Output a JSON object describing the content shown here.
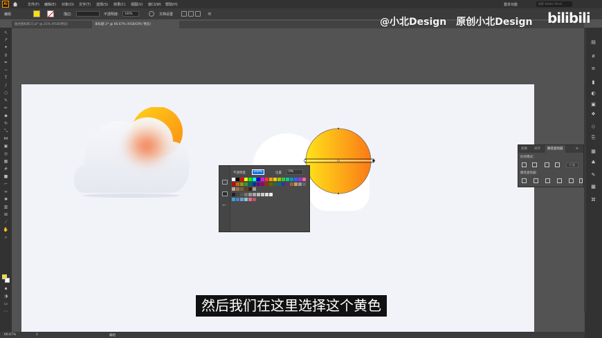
{
  "menubar": {
    "app_logo": "Ai",
    "items": [
      "文件(F)",
      "编辑(E)",
      "对象(O)",
      "文字(T)",
      "选择(S)",
      "效果(C)",
      "视图(V)",
      "窗口(W)",
      "帮助(H)"
    ],
    "workspace": "基本功能",
    "search_placeholder": "搜索 Adobe Stock"
  },
  "controlbar": {
    "object_label": "编组",
    "stroke_label": "描边:",
    "opacity_label": "不透明度:",
    "opacity_value": "100%",
    "style_label": "样式:",
    "doc_setup_label": "文档设置"
  },
  "tabs": [
    {
      "label": "融合图标练习.ai* @ 25% (RGB/预览)",
      "active": false
    },
    {
      "label": "未标题-2* @ 66.67% (RGB/GPU 预览)",
      "active": true
    }
  ],
  "watermark": {
    "text": "@小北Design　原创小北Design",
    "brand": "bilibili"
  },
  "swatches_popup": {
    "opacity_label": "不透明度",
    "opacity_value": "100%",
    "mode_label": "位置",
    "mode_value": "0%"
  },
  "pathfinder": {
    "tabs": [
      "变换",
      "对齐",
      "路径查找器"
    ],
    "shape_modes_label": "形状模式：",
    "pathfinders_label": "路径查找器：",
    "expand_label": "扩展"
  },
  "statusbar": {
    "zoom": "66.67%",
    "page": "1",
    "tool": "编组"
  },
  "subtitle": "然后我们在这里选择这个黄色",
  "colors": {
    "fill": "#ffe000",
    "sun_gradient": [
      "#ffe31a",
      "#fb7a16"
    ],
    "cloud_shadow": "#f37a3a",
    "selection_accent": "#1473e6"
  }
}
